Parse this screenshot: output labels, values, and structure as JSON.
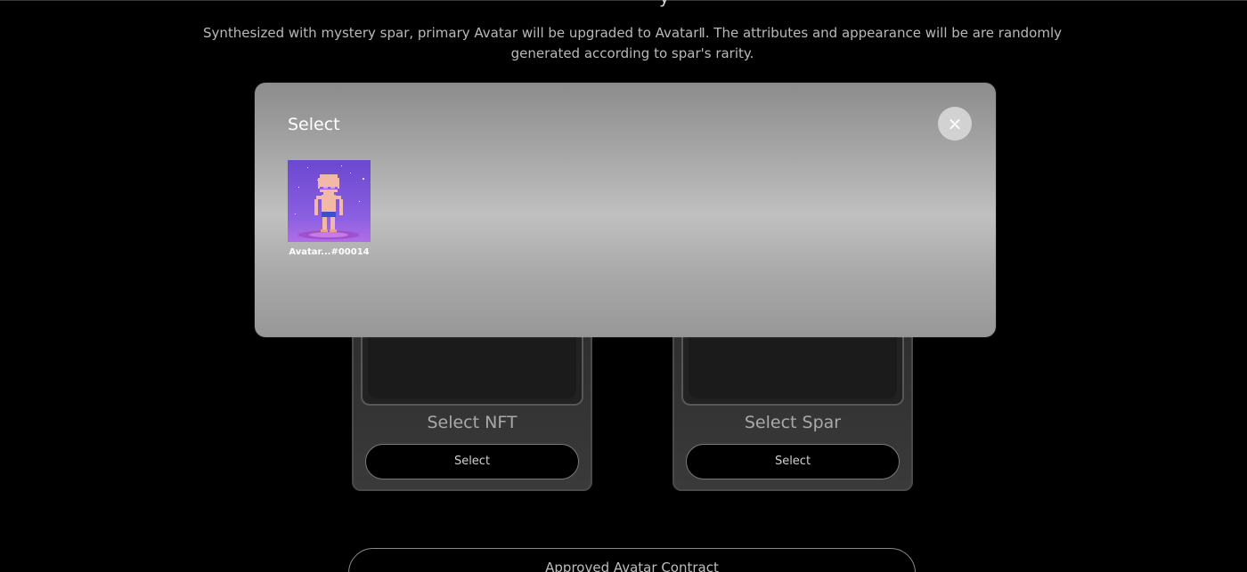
{
  "header": {
    "title_fragment": "y",
    "description": "Synthesized with mystery spar, primary Avatar will be upgraded to AvatarⅡ. The attributes and appearance will be are randomly generated according to spar's rarity."
  },
  "cards": [
    {
      "label": "Select NFT",
      "button": "Select"
    },
    {
      "label": "Select Spar",
      "button": "Select"
    }
  ],
  "approve_button": "Approved Avatar Contract",
  "modal": {
    "title": "Select",
    "close_glyph": "×",
    "items": [
      {
        "name": "Avatar...#00014",
        "icon": "avatar-nft-thumbnail"
      }
    ]
  },
  "colors": {
    "background": "#000000",
    "modal_top": "#8c8c8c",
    "modal_mid": "#c0c0c0",
    "nft_bg": "#7b4fd6"
  }
}
